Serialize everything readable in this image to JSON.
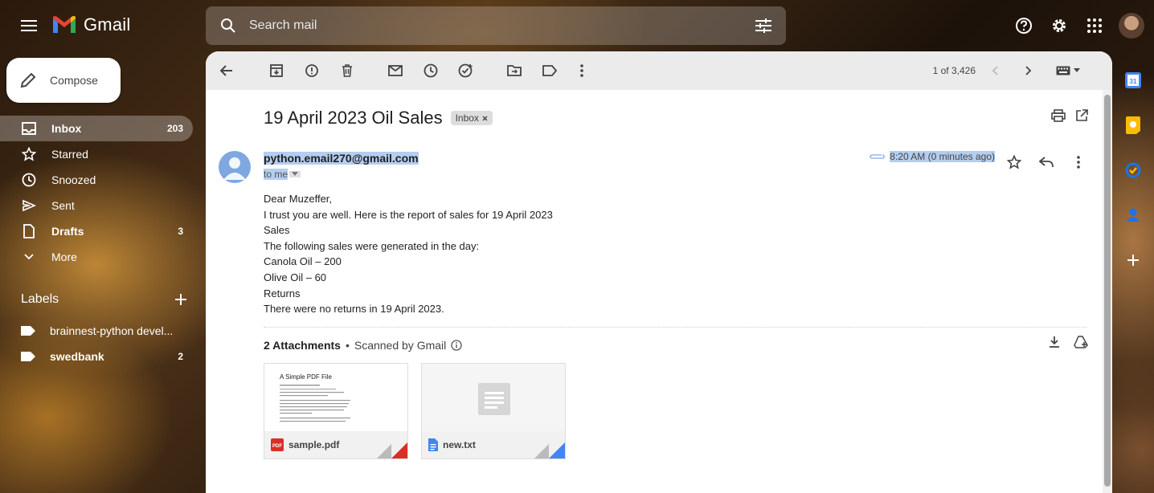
{
  "app": {
    "name": "Gmail",
    "brand_colors": [
      "#ea4335",
      "#fbbc04",
      "#34a853",
      "#4285f4"
    ]
  },
  "search": {
    "placeholder": "Search mail"
  },
  "compose": {
    "label": "Compose"
  },
  "nav": [
    {
      "label": "Inbox",
      "count": "203",
      "icon": "inbox-icon"
    },
    {
      "label": "Starred",
      "count": "",
      "icon": "star-icon"
    },
    {
      "label": "Snoozed",
      "count": "",
      "icon": "clock-icon"
    },
    {
      "label": "Sent",
      "count": "",
      "icon": "send-icon"
    },
    {
      "label": "Drafts",
      "count": "3",
      "icon": "draft-icon"
    },
    {
      "label": "More",
      "count": "",
      "icon": "chevron-down-icon"
    }
  ],
  "labels": {
    "title": "Labels",
    "items": [
      {
        "label": "brainnest-python devel...",
        "count": ""
      },
      {
        "label": "swedbank",
        "count": "2"
      }
    ]
  },
  "pager": {
    "text": "1 of 3,426"
  },
  "email": {
    "subject": "19 April 2023 Oil Sales",
    "chip": "Inbox",
    "sender": "python.email270@gmail.com",
    "to": "to me",
    "time": "8:20 AM (0 minutes ago)",
    "body": [
      "Dear Muzeffer,",
      "I trust you are well.  Here is the report of sales for 19 April 2023",
      "Sales",
      "The following sales were generated in the day:",
      "Canola Oil – 200",
      "Olive Oil – 60",
      "Returns",
      "There were no returns in 19 April 2023."
    ]
  },
  "attachments": {
    "count_label": "2 Attachments",
    "separator": "•",
    "scanned": "Scanned by Gmail",
    "files": [
      {
        "name": "sample.pdf",
        "preview_title": "A Simple PDF File",
        "type_color": "#d93025"
      },
      {
        "name": "new.txt",
        "preview_title": "",
        "type_color": "#4285f4"
      }
    ]
  }
}
